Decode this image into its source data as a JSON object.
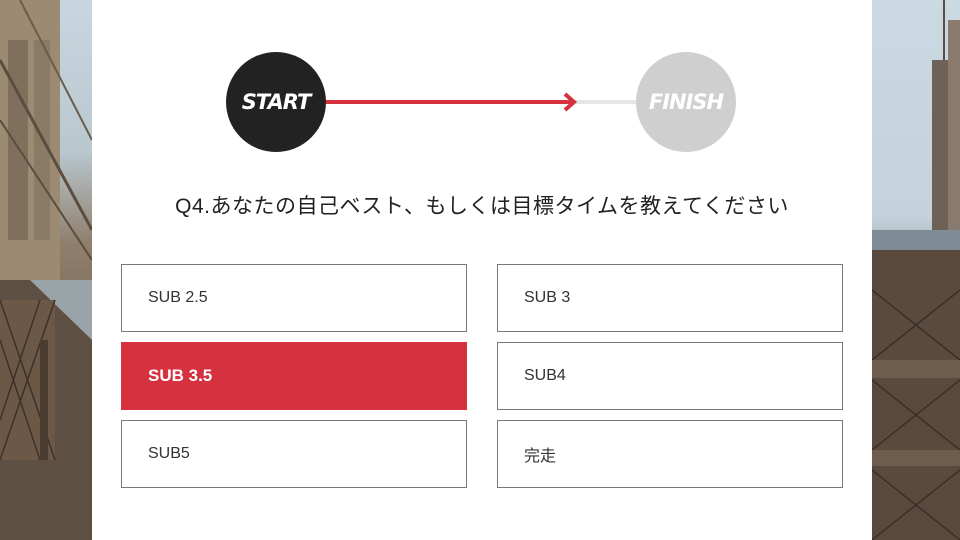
{
  "progress": {
    "start_label": "START",
    "finish_label": "FINISH",
    "accent_color": "#d5313e",
    "completed_fraction": 0.8
  },
  "question": {
    "text": "Q4.あなたの自己ベスト、もしくは目標タイムを教えてください"
  },
  "options": [
    {
      "label": "SUB 2.5",
      "selected": false
    },
    {
      "label": "SUB 3",
      "selected": false
    },
    {
      "label": "SUB 3.5",
      "selected": true
    },
    {
      "label": "SUB4",
      "selected": false
    },
    {
      "label": "SUB5",
      "selected": false
    },
    {
      "label": "完走",
      "selected": false
    }
  ],
  "background": {
    "left_image": "bridge-photo",
    "right_image": "bridge-city-photo"
  }
}
